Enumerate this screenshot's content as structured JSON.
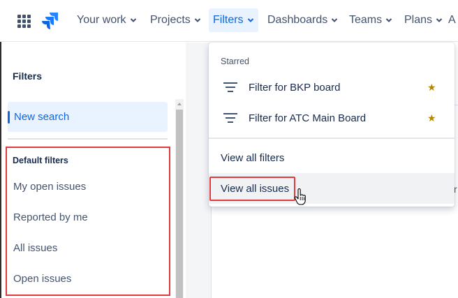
{
  "nav": {
    "items": [
      {
        "label": "Your work",
        "active": false
      },
      {
        "label": "Projects",
        "active": false
      },
      {
        "label": "Filters",
        "active": true
      },
      {
        "label": "Dashboards",
        "active": false
      },
      {
        "label": "Teams",
        "active": false
      },
      {
        "label": "Plans",
        "active": false
      },
      {
        "label": "A",
        "active": false
      }
    ]
  },
  "sidebar": {
    "title": "Filters",
    "new_search": "New search",
    "default_filters": {
      "heading": "Default filters",
      "items": [
        "My open issues",
        "Reported by me",
        "All issues",
        "Open issues"
      ]
    }
  },
  "dropdown": {
    "section_label": "Starred",
    "starred": [
      {
        "label": "Filter for BKP board",
        "icon": "filter-icon",
        "starred": true
      },
      {
        "label": "Filter for ATC Main Board",
        "icon": "filter-icon",
        "starred": true
      }
    ],
    "view_all_filters": "View all filters",
    "view_all_issues": "View all issues"
  },
  "main": {
    "edge_fragment": "r"
  },
  "colors": {
    "accent": "#0c66e4",
    "active_bg": "#e9f2ff",
    "highlight_box": "#e0393e",
    "star": "#b38600"
  }
}
